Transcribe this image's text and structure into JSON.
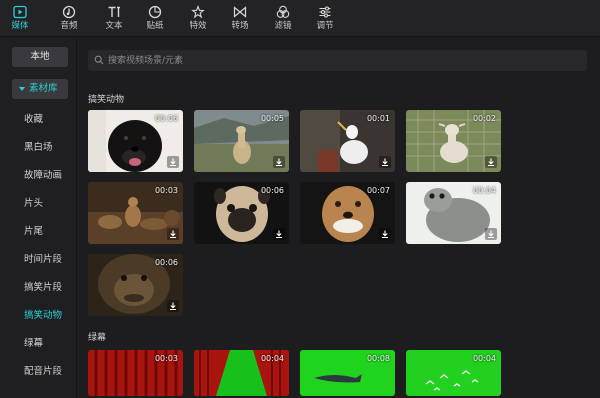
{
  "toolbar": {
    "items": [
      {
        "label": "媒体",
        "icon": "media-icon"
      },
      {
        "label": "音频",
        "icon": "audio-icon"
      },
      {
        "label": "文本",
        "icon": "text-icon"
      },
      {
        "label": "贴纸",
        "icon": "sticker-icon"
      },
      {
        "label": "特效",
        "icon": "effects-icon"
      },
      {
        "label": "转场",
        "icon": "transition-icon"
      },
      {
        "label": "滤镜",
        "icon": "filter-icon"
      },
      {
        "label": "调节",
        "icon": "adjust-icon"
      }
    ],
    "active_index": 0,
    "accent_color": "#2bd0d5"
  },
  "sidebar": {
    "local_label": "本地",
    "library_label": "素材库",
    "items": [
      "收藏",
      "黑白场",
      "故障动画",
      "片头",
      "片尾",
      "时间片段",
      "搞笑片段",
      "搞笑动物",
      "绿幕",
      "配音片段"
    ],
    "active_item": "搞笑动物"
  },
  "search": {
    "placeholder": "搜索视频场景/元素"
  },
  "sections": [
    {
      "title": "搞笑动物",
      "clips": [
        {
          "duration": "00:06",
          "subject": "black dog"
        },
        {
          "duration": "00:05",
          "subject": "llama"
        },
        {
          "duration": "00:01",
          "subject": "seagull"
        },
        {
          "duration": "00:02",
          "subject": "goat"
        },
        {
          "duration": "00:03",
          "subject": "squirrel"
        },
        {
          "duration": "00:06",
          "subject": "pug"
        },
        {
          "duration": "00:07",
          "subject": "dog"
        },
        {
          "duration": "00:04",
          "subject": "seal"
        },
        {
          "duration": "00:06",
          "subject": "chimpanzee"
        }
      ]
    },
    {
      "title": "绿幕",
      "clips": [
        {
          "duration": "00:03",
          "subject": "red curtain"
        },
        {
          "duration": "00:04",
          "subject": "red curtain on green"
        },
        {
          "duration": "00:08",
          "subject": "whale on green"
        },
        {
          "duration": "00:04",
          "subject": "birds on green"
        }
      ]
    }
  ]
}
